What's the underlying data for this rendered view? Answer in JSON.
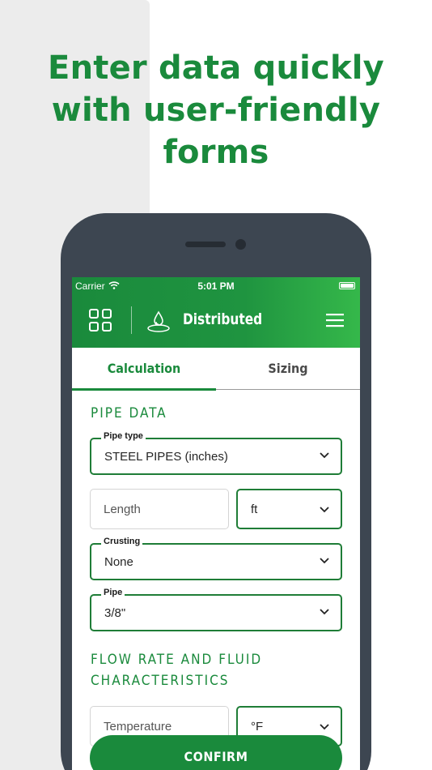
{
  "headline": {
    "line1": "Enter data quickly",
    "line2": "with user-friendly",
    "line3": "forms"
  },
  "status_bar": {
    "carrier": "Carrier",
    "time": "5:01 PM",
    "wifi_icon": "wifi-icon",
    "battery_icon": "battery-icon"
  },
  "app_bar": {
    "title": "Distributed",
    "grid_icon": "grid-icon",
    "logo_icon": "water-drop-icon",
    "menu_icon": "hamburger-menu-icon"
  },
  "tabs": [
    {
      "label": "Calculation",
      "active": true
    },
    {
      "label": "Sizing",
      "active": false
    }
  ],
  "sections": {
    "pipe_data_title": "PIPE DATA",
    "flow_title_line1": "FLOW RATE AND FLUID",
    "flow_title_line2": "CHARACTERISTICS"
  },
  "form": {
    "pipe_type": {
      "label": "Pipe type",
      "value": "STEEL PIPES (inches)"
    },
    "length": {
      "placeholder": "Length"
    },
    "length_unit": {
      "value": "ft"
    },
    "crusting": {
      "label": "Crusting",
      "value": "None"
    },
    "pipe": {
      "label": "Pipe",
      "value": "3/8\""
    },
    "temperature": {
      "placeholder": "Temperature"
    },
    "temperature_unit": {
      "value": "°F"
    }
  },
  "confirm_label": "CONFIRM",
  "colors": {
    "brand_green": "#1a8a3c",
    "phone_frame": "#3d4651"
  }
}
